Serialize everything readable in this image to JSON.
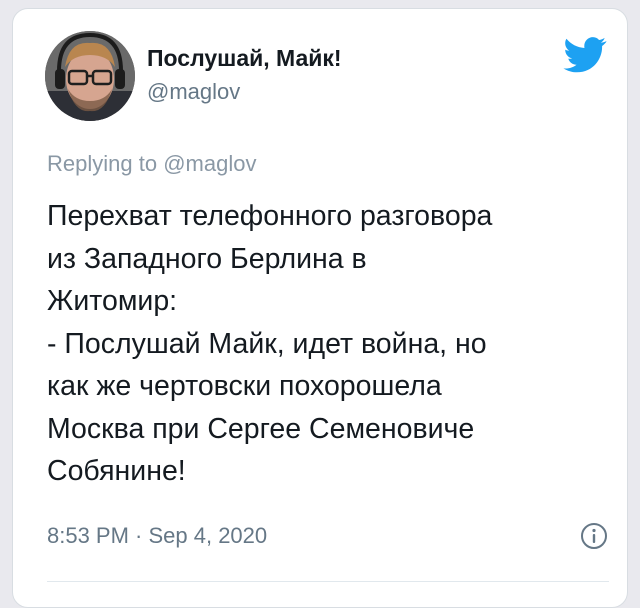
{
  "tweet": {
    "display_name": "Послушай, Майк!",
    "handle": "@maglov",
    "reply_prefix": "Replying to ",
    "reply_to": "@maglov",
    "lines": [
      "Перехват телефонного разговора",
      "из Западного Берлина в",
      "Житомир:",
      "- Послушай Майк, идет война, но",
      "как же чертовски похорошела",
      "Москва при Сергее Семеновиче",
      "Собянине!"
    ],
    "timestamp": "8:53 PM · Sep 4, 2020"
  },
  "icons": {
    "brand": "twitter-bird-icon",
    "info": "info-icon"
  },
  "colors": {
    "brand_blue": "#1da1f2",
    "text": "#141a20",
    "secondary": "#657786"
  }
}
